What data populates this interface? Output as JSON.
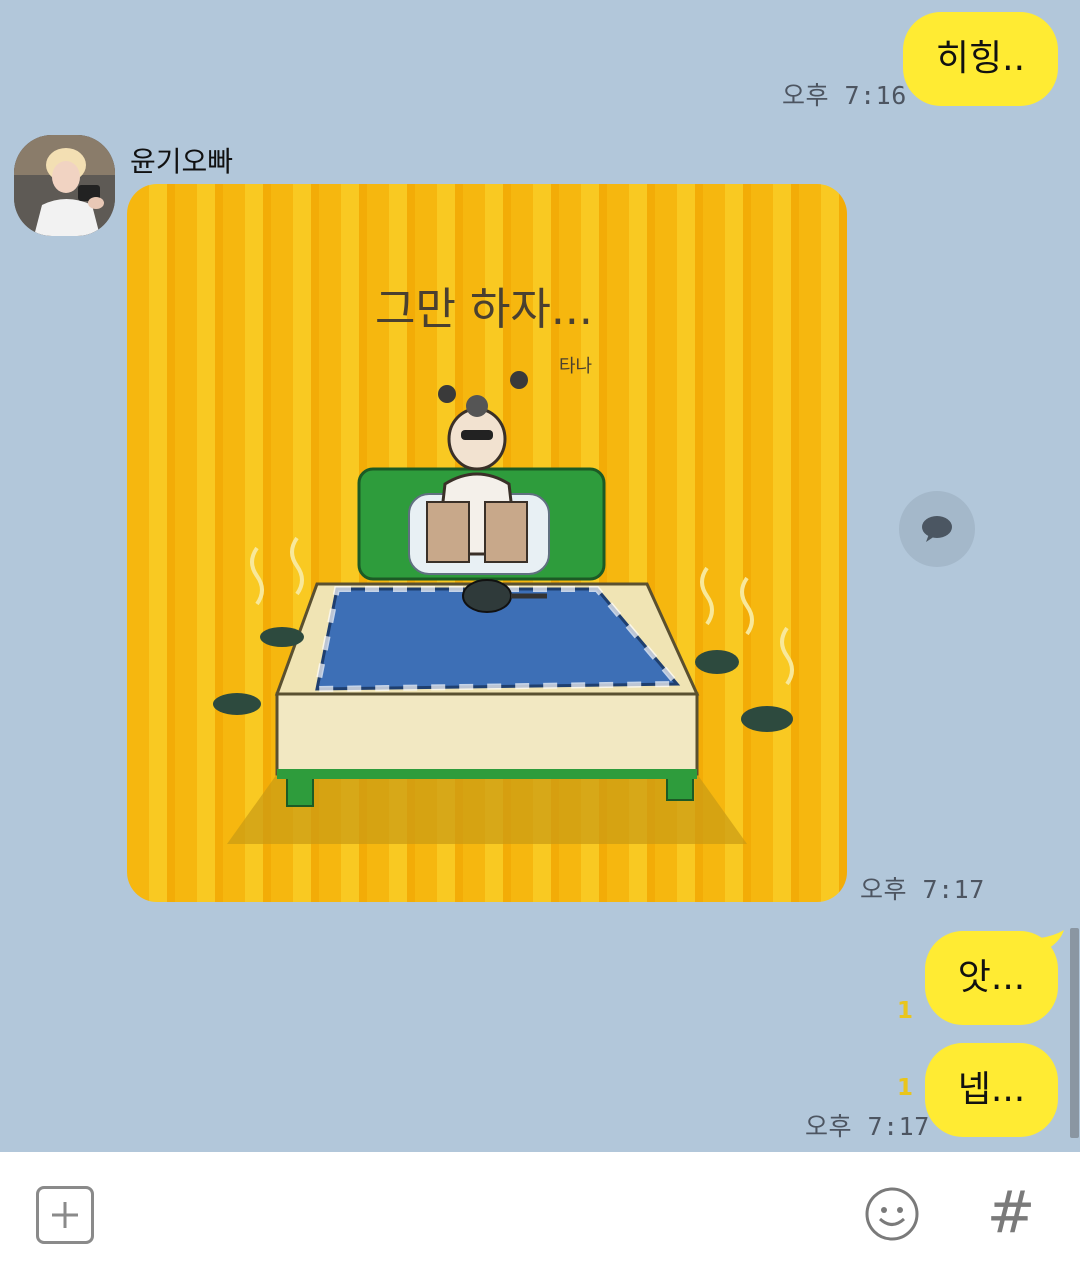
{
  "messages": {
    "m1": {
      "text": "히힝..",
      "time": "오후 7:16"
    },
    "sender": {
      "name": "윤기오빠"
    },
    "photo": {
      "caption": "그만 하자...",
      "artist": "타나",
      "time": "오후 7:17"
    },
    "m2": {
      "text": "앗...",
      "unread": "1"
    },
    "m3": {
      "text": "넵...",
      "unread": "1",
      "time": "오후 7:17"
    }
  },
  "colors": {
    "background": "#b2c7da",
    "my_bubble": "#ffeb33",
    "unread": "#e9c51c"
  },
  "icons": {
    "share": "speech-bubble-icon",
    "attach": "plus-icon",
    "emoticon": "smiley-icon",
    "hashtag": "hash-icon"
  },
  "inputbar": {
    "hash": "#"
  }
}
